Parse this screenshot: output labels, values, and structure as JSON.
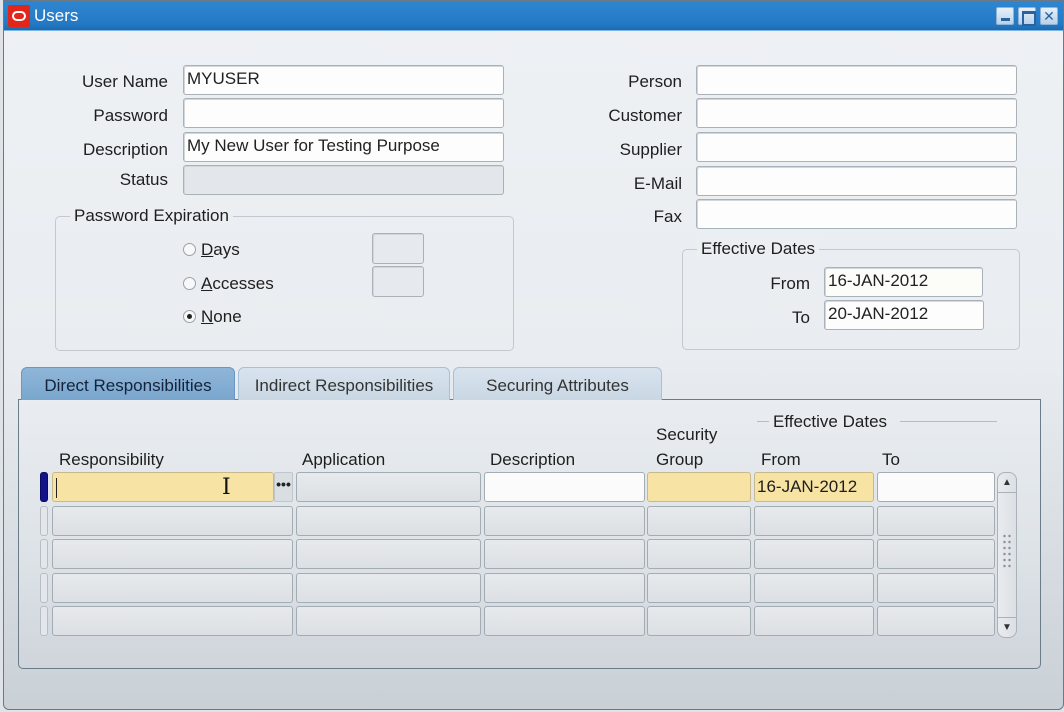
{
  "window": {
    "title": "Users",
    "controls": {
      "minimize": "minimize",
      "maximize": "maximize",
      "close": "✕"
    }
  },
  "user_form": {
    "user_name": {
      "label": "User Name",
      "value": "MYUSER"
    },
    "password": {
      "label": "Password",
      "value": ""
    },
    "description": {
      "label": "Description",
      "value": "My New User for Testing Purpose"
    },
    "status": {
      "label": "Status",
      "value": ""
    }
  },
  "links_form": {
    "person": {
      "label": "Person",
      "value": ""
    },
    "customer": {
      "label": "Customer",
      "value": ""
    },
    "supplier": {
      "label": "Supplier",
      "value": ""
    },
    "email": {
      "label": "E-Mail",
      "value": ""
    },
    "fax": {
      "label": "Fax",
      "value": ""
    }
  },
  "password_expiration": {
    "title": "Password Expiration",
    "options": [
      {
        "mnemonic": "D",
        "rest": "ays",
        "selected": false,
        "value": ""
      },
      {
        "mnemonic": "A",
        "rest": "ccesses",
        "selected": false,
        "value": ""
      },
      {
        "mnemonic": "N",
        "rest": "one",
        "selected": true
      }
    ]
  },
  "effective_dates": {
    "title": "Effective Dates",
    "from": {
      "label": "From",
      "value": "16-JAN-2012"
    },
    "to": {
      "label": "To",
      "value": "20-JAN-2012"
    }
  },
  "tabs": [
    {
      "label": "Direct Responsibilities",
      "active": true
    },
    {
      "label": "Indirect Responsibilities",
      "active": false
    },
    {
      "label": "Securing Attributes",
      "active": false
    }
  ],
  "grid": {
    "group_header": "Effective Dates",
    "columns": {
      "responsibility": "Responsibility",
      "application": "Application",
      "description": "Description",
      "security_group_line1": "Security",
      "security_group_line2": "Group",
      "from": "From",
      "to": "To"
    },
    "rows": [
      {
        "responsibility": "",
        "application": "",
        "description": "",
        "security_group": "",
        "from": "16-JAN-2012",
        "to": ""
      },
      {
        "responsibility": "",
        "application": "",
        "description": "",
        "security_group": "",
        "from": "",
        "to": ""
      },
      {
        "responsibility": "",
        "application": "",
        "description": "",
        "security_group": "",
        "from": "",
        "to": ""
      },
      {
        "responsibility": "",
        "application": "",
        "description": "",
        "security_group": "",
        "from": "",
        "to": ""
      },
      {
        "responsibility": "",
        "application": "",
        "description": "",
        "security_group": "",
        "from": "",
        "to": ""
      }
    ],
    "lov_label": "•••"
  },
  "scrollbar": {
    "up": "▲",
    "down": "▼"
  }
}
